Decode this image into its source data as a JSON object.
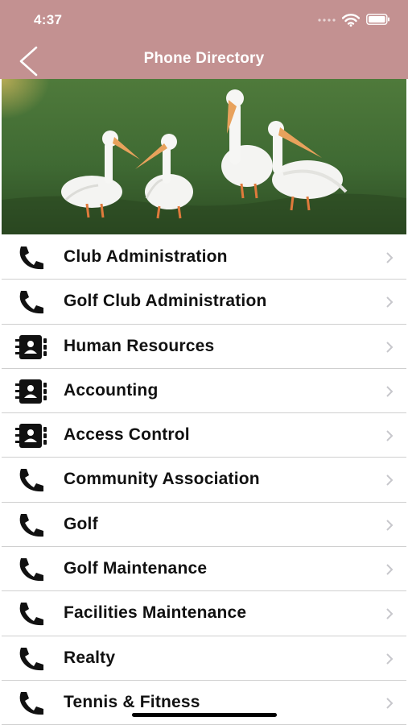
{
  "status_bar": {
    "time": "4:37"
  },
  "nav": {
    "title": "Phone Directory",
    "back_icon": "chevron-left-icon"
  },
  "hero": {
    "description_icon": "pelicans-photo"
  },
  "colors": {
    "header": "#c39191",
    "text": "#111111",
    "divider": "#cfcfcf",
    "chevron": "#c7c7cc"
  },
  "departments": [
    {
      "label": "Club Administration",
      "icon": "phone-icon"
    },
    {
      "label": "Golf Club Administration",
      "icon": "phone-icon"
    },
    {
      "label": "Human Resources",
      "icon": "contact-book-icon"
    },
    {
      "label": "Accounting",
      "icon": "contact-book-icon"
    },
    {
      "label": "Access Control",
      "icon": "contact-book-icon"
    },
    {
      "label": "Community Association",
      "icon": "phone-icon"
    },
    {
      "label": "Golf",
      "icon": "phone-icon"
    },
    {
      "label": "Golf Maintenance",
      "icon": "phone-icon"
    },
    {
      "label": "Facilities Maintenance",
      "icon": "phone-icon"
    },
    {
      "label": "Realty",
      "icon": "phone-icon"
    },
    {
      "label": "Tennis & Fitness",
      "icon": "phone-icon"
    }
  ]
}
